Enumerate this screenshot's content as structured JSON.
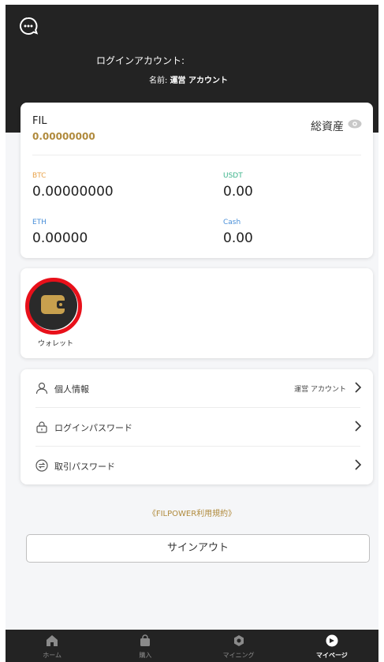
{
  "header": {
    "login_label": "ログインアカウント:",
    "name_prefix": "名前:",
    "name_value": "運営 アカウント"
  },
  "assets": {
    "fil_label": "FIL",
    "fil_value": "0.00000000",
    "total_label": "総資産",
    "coins": [
      {
        "label": "BTC",
        "value": "0.00000000",
        "color": "#e8a24a"
      },
      {
        "label": "USDT",
        "value": "0.00",
        "color": "#3bb38a"
      },
      {
        "label": "ETH",
        "value": "0.00000",
        "color": "#4a90d9"
      },
      {
        "label": "Cash",
        "value": "0.00",
        "color": "#4a90d9"
      }
    ]
  },
  "wallet": {
    "label": "ウォレット"
  },
  "menu": {
    "items": [
      {
        "label": "個人情報",
        "value": "運営 アカウント",
        "icon": "person-icon"
      },
      {
        "label": "ログインパスワード",
        "value": "",
        "icon": "lock-icon"
      },
      {
        "label": "取引パスワード",
        "value": "",
        "icon": "exchange-icon"
      }
    ]
  },
  "terms_link": "《FILPOWER利用規約》",
  "signout_label": "サインアウト",
  "tabbar": {
    "tabs": [
      {
        "label": "ホーム",
        "icon": "home-icon",
        "active": false
      },
      {
        "label": "購入",
        "icon": "bag-icon",
        "active": false
      },
      {
        "label": "マイニング",
        "icon": "mining-icon",
        "active": false
      },
      {
        "label": "マイページ",
        "icon": "mypage-icon",
        "active": true
      }
    ]
  },
  "colors": {
    "header_bg": "#232323",
    "accent_gold": "#b08a3c",
    "highlight_ring": "#e8101a"
  }
}
